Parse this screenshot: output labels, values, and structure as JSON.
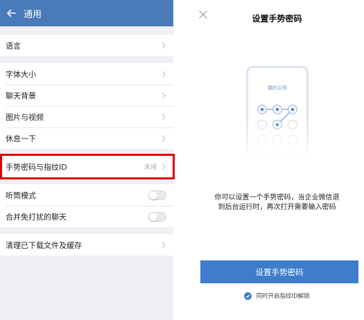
{
  "settings": {
    "header_title": "通用",
    "language_label": "语言",
    "font_size_label": "字体大小",
    "chat_background_label": "聊天背景",
    "images_videos_label": "图片与视频",
    "take_break_label": "休息一下",
    "gesture_fingerprint_label": "手势密码与指纹ID",
    "gesture_fingerprint_value": "关闭",
    "earpiece_mode_label": "听筒模式",
    "merge_chats_label": "合并免打扰的聊天",
    "clear_cache_label": "清理已下载文件及缓存"
  },
  "gesture": {
    "title": "设置手势密码",
    "company_label": "我的公司",
    "description_line1": "你可以设置一个手势密码，当企业微信退",
    "description_line2": "到后台运行时，再次打开需要输入密码",
    "primary_button": "设置手势密码",
    "fingerprint_option": "同时开启指纹ID解锁"
  },
  "colors": {
    "header_blue": "#4a7ab9",
    "button_blue": "#3d7dcb",
    "highlight_red": "#e20000"
  },
  "toggles": {
    "earpiece_mode": false,
    "merge_chats": false
  },
  "fingerprint_checked": true
}
